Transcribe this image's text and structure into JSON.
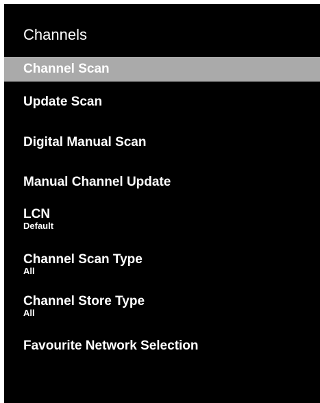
{
  "menu": {
    "title": "Channels",
    "items": [
      {
        "label": "Channel Scan",
        "selected": true
      },
      {
        "label": "Update Scan"
      },
      {
        "label": "Digital Manual Scan"
      },
      {
        "label": "Manual Channel Update"
      },
      {
        "label": "LCN",
        "value": "Default"
      },
      {
        "label": "Channel Scan Type",
        "value": "All"
      },
      {
        "label": "Channel Store Type",
        "value": "All"
      },
      {
        "label": "Favourite Network Selection"
      }
    ]
  },
  "colors": {
    "background": "#000000",
    "text": "#ffffff",
    "highlight": "#aaaaaa"
  }
}
